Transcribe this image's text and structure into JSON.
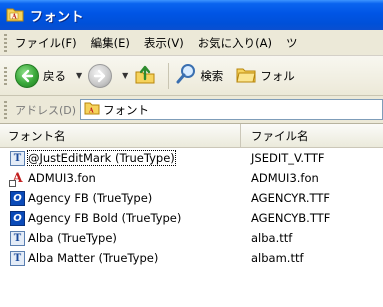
{
  "window": {
    "title": "フォント"
  },
  "menu": {
    "items": [
      "ファイル(F)",
      "編集(E)",
      "表示(V)",
      "お気に入り(A)",
      "ツ"
    ]
  },
  "toolbar": {
    "back_label": "戻る",
    "search_label": "検索",
    "folders_label": "フォル"
  },
  "address": {
    "label": "アドレス(D)",
    "value": "フォント"
  },
  "columns": {
    "name": "フォント名",
    "file": "ファイル名"
  },
  "fonts": [
    {
      "name": "@JustEditMark (TrueType)",
      "file": "JSEDIT_V.TTF",
      "icon": "truetype-font-icon",
      "selected": true
    },
    {
      "name": "ADMUI3.fon",
      "file": "ADMUI3.fon",
      "icon": "bitmap-font-icon"
    },
    {
      "name": "Agency FB (TrueType)",
      "file": "AGENCYR.TTF",
      "icon": "opentype-font-icon"
    },
    {
      "name": "Agency FB Bold (TrueType)",
      "file": "AGENCYB.TTF",
      "icon": "opentype-font-icon"
    },
    {
      "name": "Alba (TrueType)",
      "file": "alba.ttf",
      "icon": "truetype-font-icon"
    },
    {
      "name": "Alba Matter (TrueType)",
      "file": "albam.ttf",
      "icon": "truetype-font-icon"
    }
  ],
  "colors": {
    "titlebar": "#0055e5",
    "chrome": "#ece9d8",
    "address_border": "#7f9db9"
  }
}
